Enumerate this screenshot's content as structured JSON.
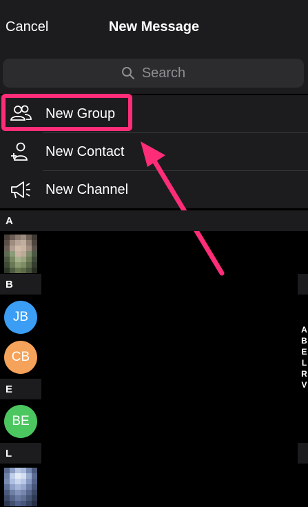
{
  "header": {
    "cancel_label": "Cancel",
    "title": "New Message"
  },
  "search": {
    "placeholder": "Search"
  },
  "menu": {
    "items": [
      {
        "label": "New Group",
        "icon": "group-icon"
      },
      {
        "label": "New Contact",
        "icon": "add-contact-icon"
      },
      {
        "label": "New Channel",
        "icon": "megaphone-icon"
      }
    ]
  },
  "contacts": {
    "sections": [
      "A",
      "B",
      "E",
      "L"
    ],
    "avatars": [
      {
        "initials": "JB",
        "color": "#3b9df4"
      },
      {
        "initials": "CB",
        "color": "#f5a25a"
      },
      {
        "initials": "BE",
        "color": "#4cc760"
      }
    ]
  },
  "index": [
    "A",
    "B",
    "E",
    "L",
    "R",
    "V"
  ],
  "colors": {
    "highlight": "#ff2d78",
    "background": "#000000",
    "panel": "#1c1c1e"
  }
}
